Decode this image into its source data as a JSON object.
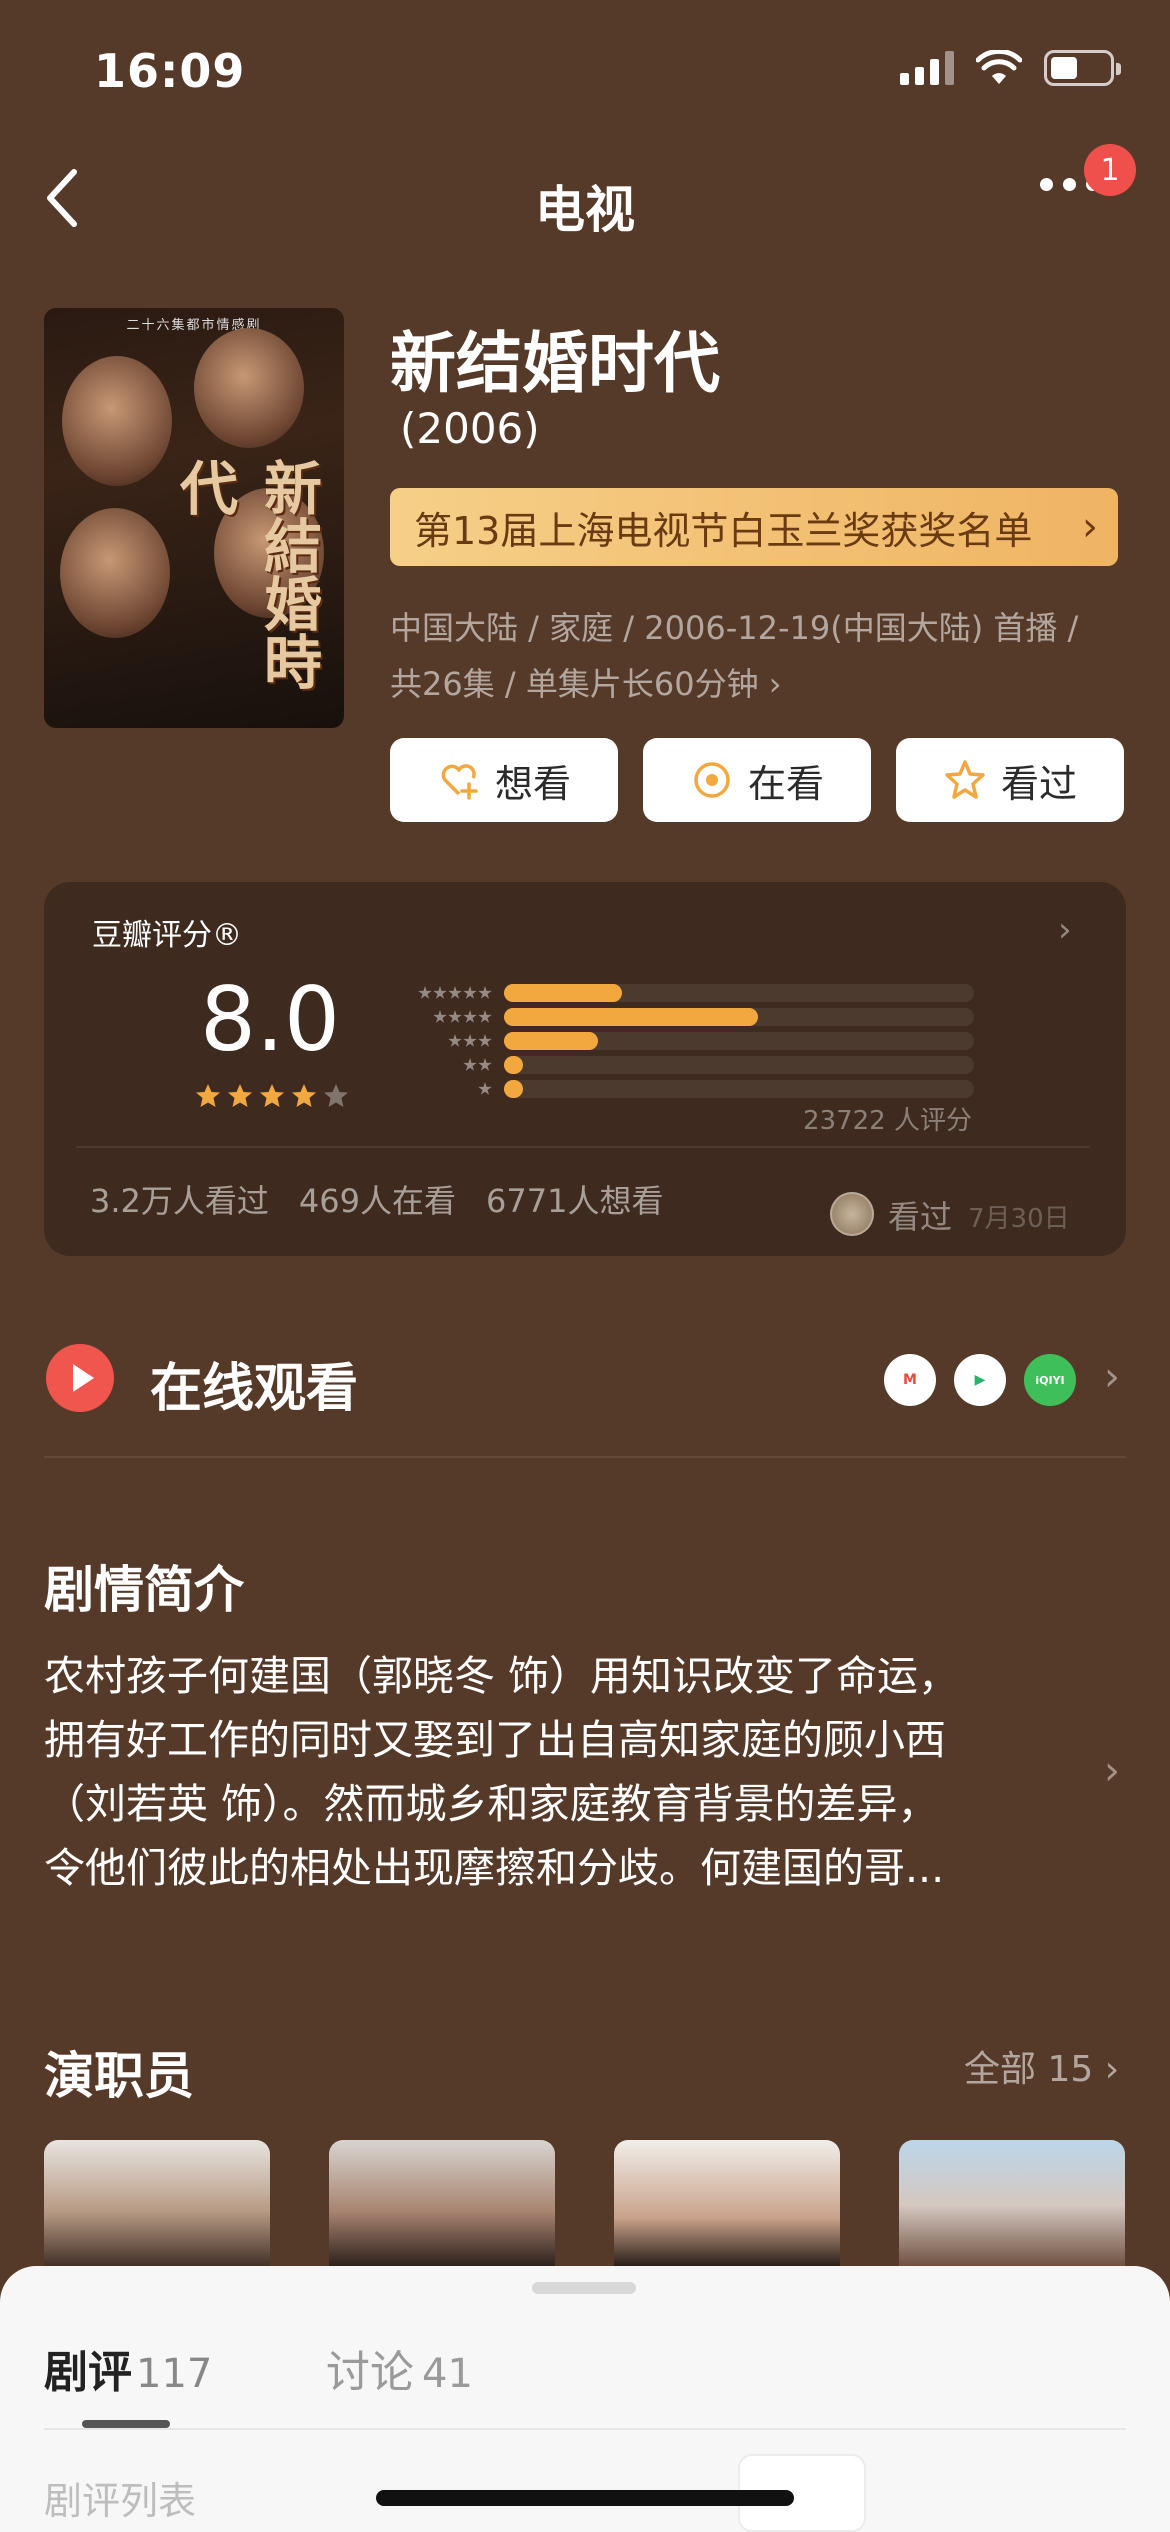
{
  "status_bar": {
    "time": "16:09"
  },
  "nav": {
    "title": "电视",
    "badge": "1"
  },
  "show": {
    "title": "新结婚时代",
    "year": "(2006)",
    "award": "第13届上海电视节白玉兰奖获奖名单",
    "meta_line1": "中国大陆 / 家庭 / 2006-12-19(中国大陆) 首播 /",
    "meta_line2": "共26集 / 单集片长60分钟",
    "poster_tagline": "二十六集都市情感剧",
    "poster_title": "新結婚時代"
  },
  "actions": {
    "want": "想看",
    "watching": "在看",
    "watched": "看过"
  },
  "rating": {
    "label": "豆瓣评分®",
    "score": "8.0",
    "score_stars": 4,
    "distribution": [
      {
        "stars": 5,
        "fraction": 0.25
      },
      {
        "stars": 4,
        "fraction": 0.54
      },
      {
        "stars": 3,
        "fraction": 0.2
      },
      {
        "stars": 2,
        "fraction": 0.04
      },
      {
        "stars": 1,
        "fraction": 0.04
      }
    ],
    "count": "23722 人评分",
    "watched_count": "3.2万人看过",
    "watching_count": "469人在看",
    "want_count": "6771人想看",
    "friend_status": "看过",
    "friend_date": "7月30日"
  },
  "online": {
    "title": "在线观看",
    "platforms": [
      "M",
      "▶",
      "iQIYI"
    ]
  },
  "synopsis": {
    "title": "剧情简介",
    "lines": [
      "农村孩子何建国（郭晓冬 饰）用知识改变了命运，",
      "拥有好工作的同时又娶到了出自高知家庭的顾小西",
      "（刘若英 饰）。然而城乡和家庭教育背景的差异，",
      "令他们彼此的相处出现摩擦和分歧。何建国的哥..."
    ]
  },
  "cast": {
    "title": "演职员",
    "all_label": "全部 15"
  },
  "sheet": {
    "tab_reviews": "剧评",
    "tab_reviews_count": "117",
    "tab_discussion": "讨论",
    "tab_discussion_count": "41",
    "list_label": "剧评列表"
  },
  "colors": {
    "background": "#563a29",
    "accent_orange": "#f2a83f",
    "play_red": "#f0554e",
    "award_gold": "#f6cf88"
  }
}
